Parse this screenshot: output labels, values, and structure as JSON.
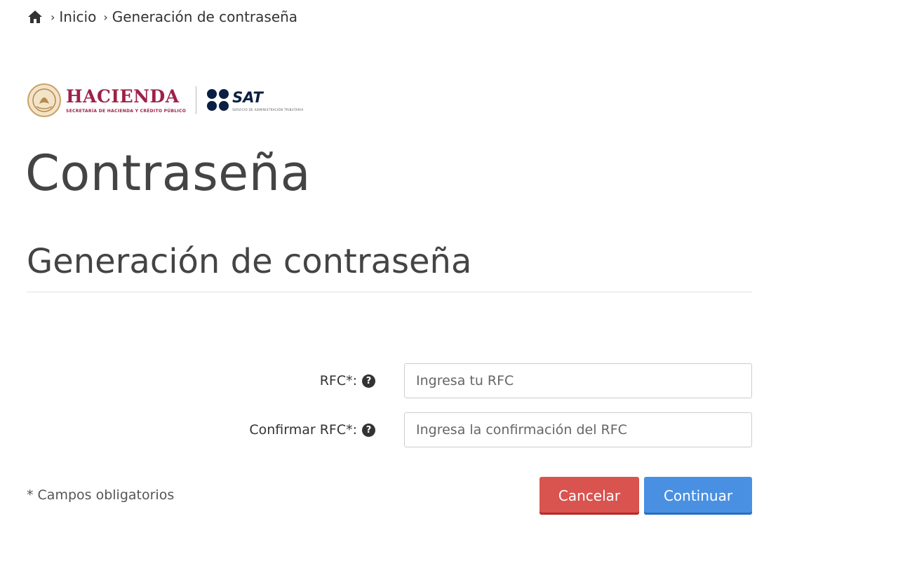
{
  "breadcrumb": {
    "home_icon": "home-icon",
    "items": [
      "Inicio",
      "Generación de contraseña"
    ]
  },
  "logos": {
    "hacienda_name": "HACIENDA",
    "hacienda_sub": "SECRETARÍA DE HACIENDA Y CRÉDITO PÚBLICO",
    "sat_name": "SAT",
    "sat_sub": "SERVICIO DE ADMINISTRACIÓN TRIBUTARIA",
    "hacienda_color": "#9d2148",
    "sat_color": "#0a1f44"
  },
  "page": {
    "title": "Contraseña",
    "section_title": "Generación de contraseña"
  },
  "form": {
    "rfc_label": "RFC*:",
    "rfc_placeholder": "Ingresa tu RFC",
    "confirm_label": "Confirmar RFC*:",
    "confirm_placeholder": "Ingresa la confirmación del RFC",
    "help_icon": "question-circle-icon",
    "required_note": "* Campos obligatorios"
  },
  "buttons": {
    "cancel_label": "Cancelar",
    "continue_label": "Continuar",
    "cancel_color": "#d9534f",
    "continue_color": "#4a90e2"
  }
}
